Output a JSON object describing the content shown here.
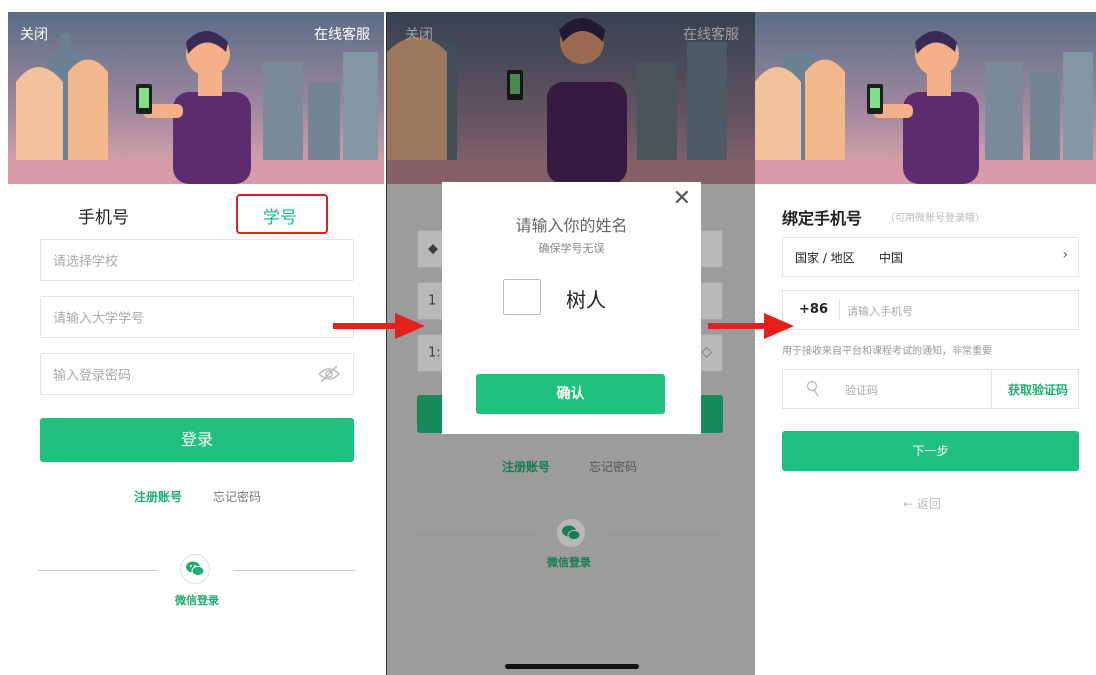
{
  "panel1": {
    "header": {
      "close_label": "关闭",
      "service_label": "在线客服"
    },
    "tabs": {
      "phone_label": "手机号",
      "student_id_label": "学号"
    },
    "fields": {
      "school_placeholder": "请选择学校",
      "student_id_placeholder": "请输入大学学号",
      "password_placeholder": "输入登录密码"
    },
    "login_button": "登录",
    "register_link": "注册账号",
    "forgot_link": "忘记密码",
    "wechat_login": "微信登录"
  },
  "panel2": {
    "header": {
      "close_label": "关闭",
      "service_label": "在线客服"
    },
    "modal": {
      "title": "请输入你的姓名",
      "subtitle": "确保学号无误",
      "name_value": "树人",
      "confirm_button": "确认"
    },
    "behind": {
      "field_prefix_1": "1",
      "field_prefix_2": "1:",
      "register_link": "注册账号",
      "forgot_link": "忘记密码",
      "wechat_login": "微信登录"
    }
  },
  "panel3": {
    "title": "绑定手机号",
    "hint": "（可用微账号登录哦）",
    "region": {
      "label": "国家 / 地区",
      "value": "中国"
    },
    "phone": {
      "code": "+86",
      "placeholder": "请输入手机号"
    },
    "notice": "用于接收来自平台和课程考试的通知，非常重要",
    "verify": {
      "placeholder": "验证码",
      "get_code": "获取验证码"
    },
    "next_button": "下一步",
    "back_link": "返回"
  },
  "colors": {
    "accent_green": "#20c07f",
    "highlight_red": "#e02020",
    "arrow_red": "#e8201c"
  }
}
